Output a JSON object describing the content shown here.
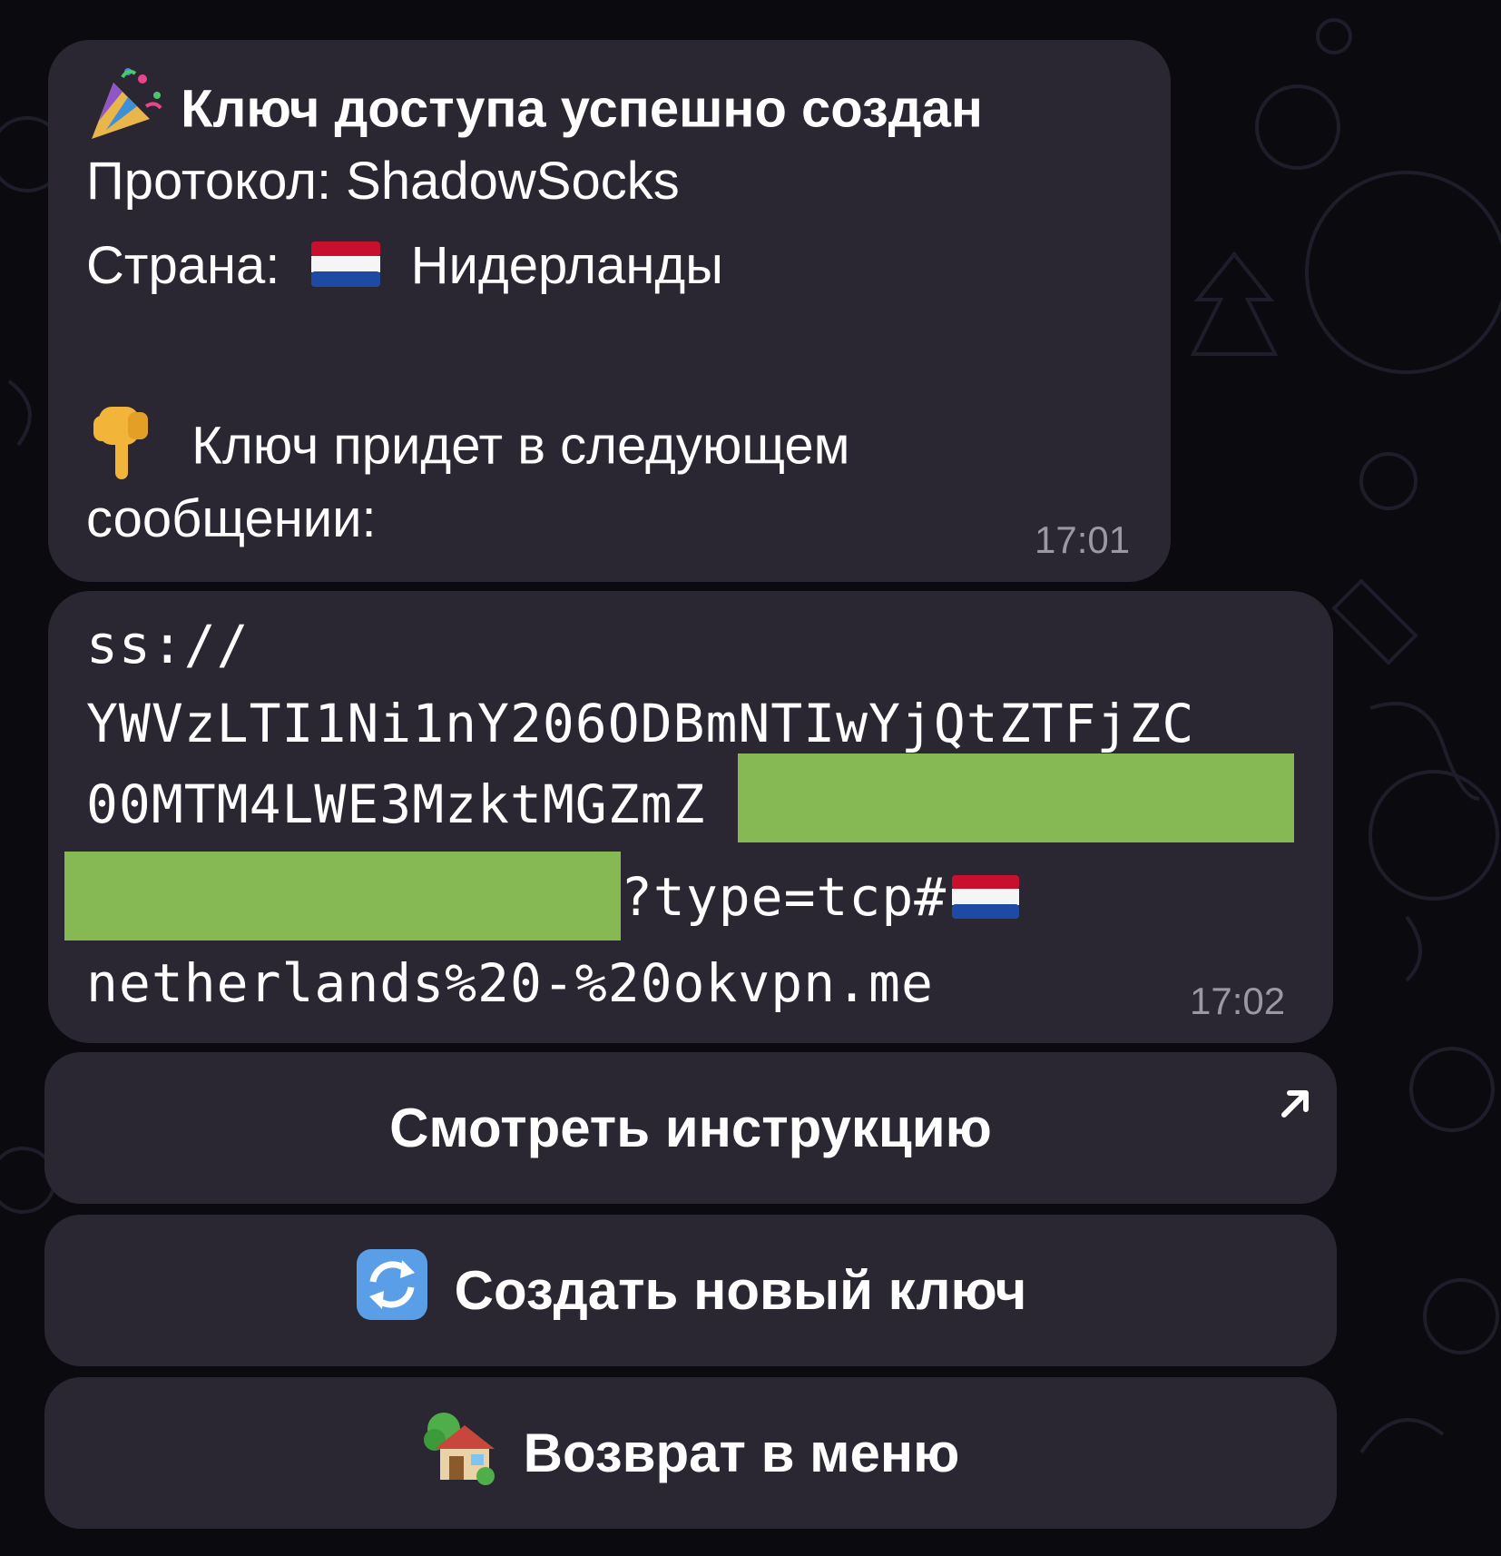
{
  "messages": [
    {
      "title": "Ключ доступа успешно создан",
      "protocol_line": "Протокол: ShadowSocks",
      "country_label": "Страна:",
      "country_name": "Нидерланды",
      "next_line_1": "Ключ придет в следующем",
      "next_line_2": "сообщении:",
      "time": "17:01",
      "icons": [
        "party-popper-icon",
        "netherlands-flag-icon",
        "pointing-down-icon"
      ]
    },
    {
      "key_line_1": "ss://",
      "key_line_2": "YWVzLTI1Ni1nY206ODBmNTIwYjQtZTFjZC",
      "key_line_3": "00MTM4LWE3MzktMGZmZ",
      "key_line_4": "?type=tcp#",
      "key_line_5": "netherlands%20-%20okvpn.me",
      "time": "17:02",
      "redaction_color": "#86b854"
    }
  ],
  "keyboard": {
    "buttons": [
      {
        "label": "Смотреть инструкцию",
        "icon": "external-arrow-icon"
      },
      {
        "label": "Создать новый ключ",
        "icon": "refresh-icon"
      },
      {
        "label": "Возврат в меню",
        "icon": "house-icon"
      }
    ]
  },
  "colors": {
    "bubble": "#2a2733",
    "background": "#0b0b0f",
    "timestamp": "#9b98a6"
  }
}
